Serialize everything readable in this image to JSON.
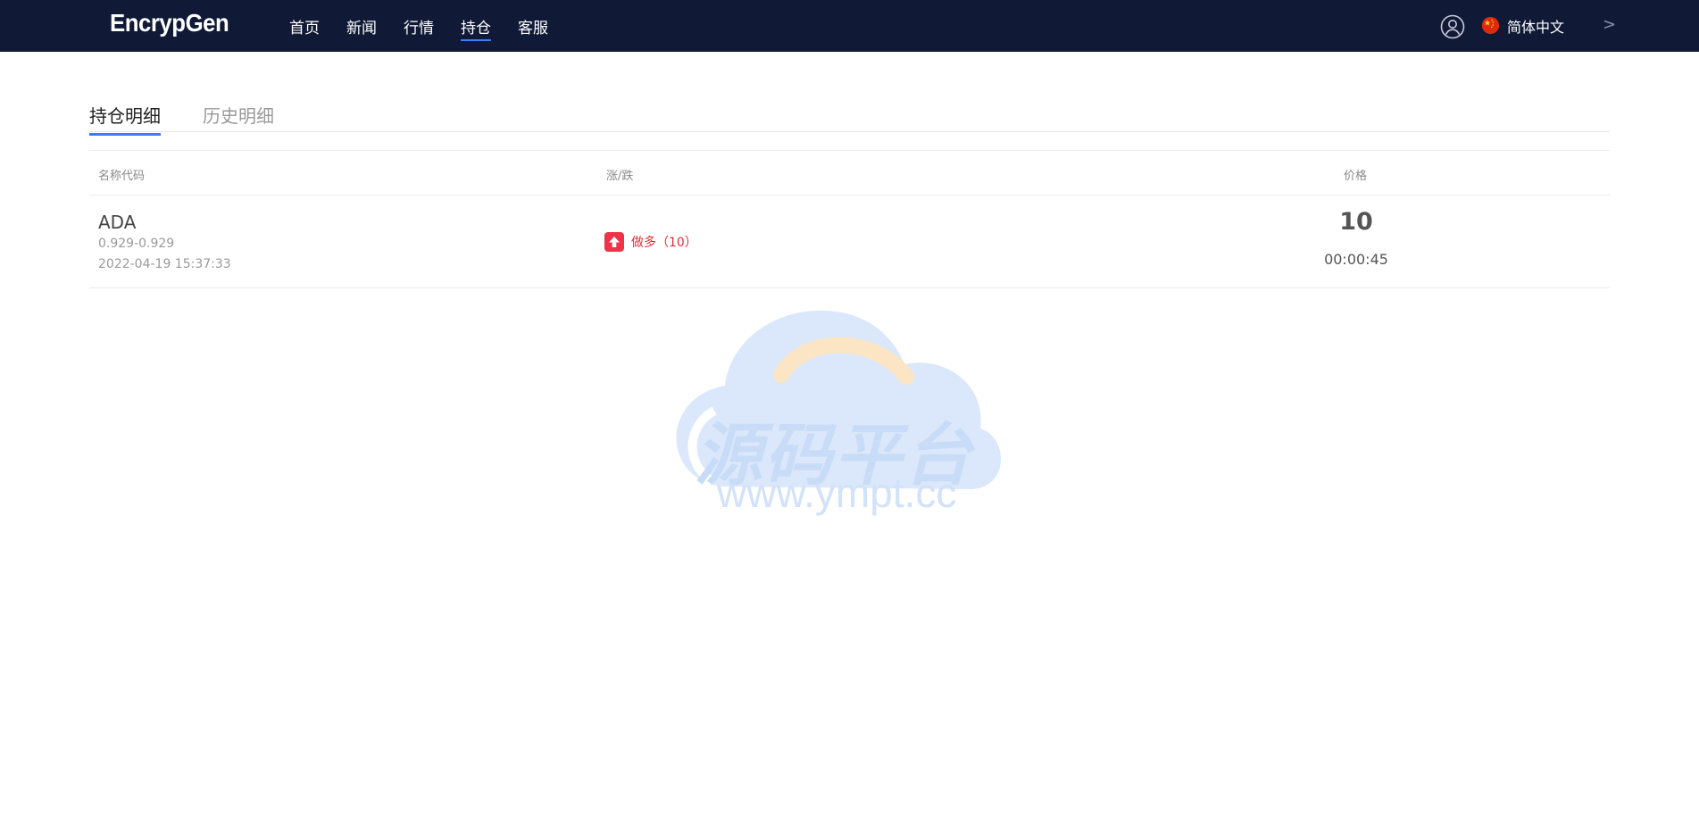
{
  "header": {
    "brand": "EncrypGen",
    "nav": [
      "首页",
      "新闻",
      "行情",
      "持仓",
      "客服"
    ],
    "active_index": 3,
    "language": "简体中文",
    "chevron": ">"
  },
  "tabs": [
    "持仓明细",
    "历史明细"
  ],
  "table": {
    "headers": [
      "名称代码",
      "涨/跌",
      "价格"
    ],
    "rows": [
      {
        "symbol": "ADA",
        "range": "0.929-0.929",
        "time": "2022-04-19 15:37:33",
        "direction": "做多（10）",
        "price": "10",
        "countdown": "00:00:45"
      }
    ]
  },
  "watermark": {
    "text": "源码平台",
    "url": "www.ympt.cc"
  },
  "colors": {
    "header_bg": "#101936",
    "accent": "#3a7bff",
    "up_red": "#ef3348"
  }
}
